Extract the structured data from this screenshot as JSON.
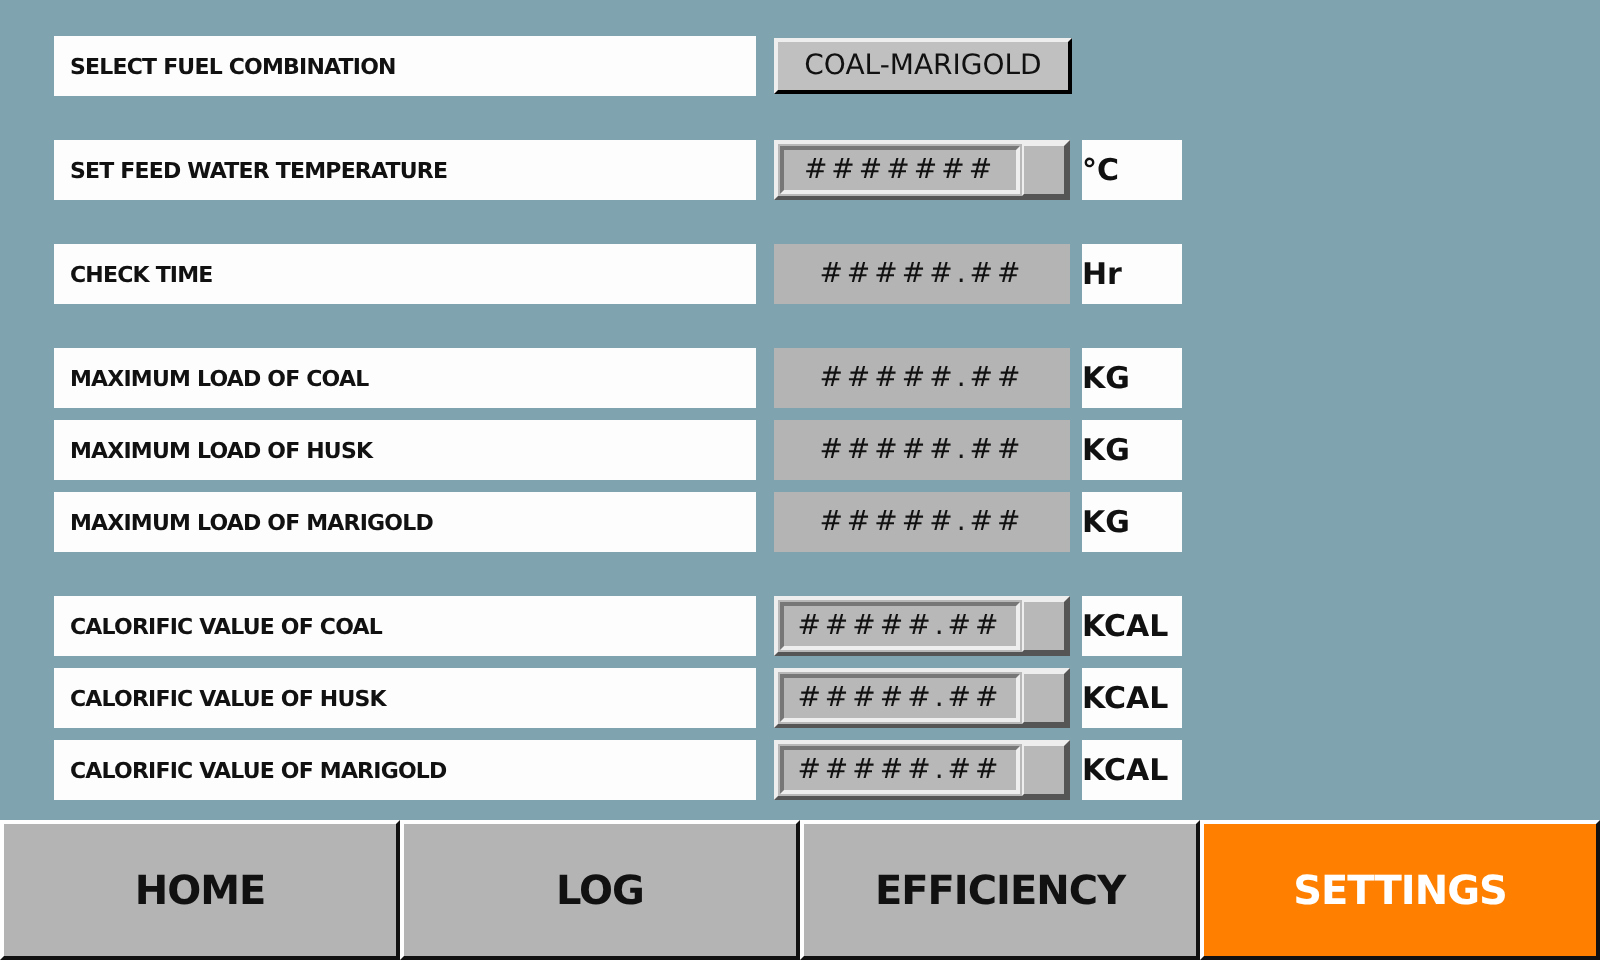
{
  "sections": [
    {
      "rows": [
        {
          "label": "SELECT FUEL COMBINATION",
          "kind": "button",
          "value": "COAL-MARIGOLD"
        }
      ]
    },
    {
      "rows": [
        {
          "label": "SET FEED WATER TEMPERATURE",
          "kind": "spinner",
          "value": "#######",
          "unit": "°C"
        }
      ]
    },
    {
      "rows": [
        {
          "label": "CHECK TIME",
          "kind": "display",
          "value": "#####.##",
          "unit": "Hr"
        }
      ]
    },
    {
      "rows": [
        {
          "label": "MAXIMUM LOAD OF COAL",
          "kind": "display",
          "value": "#####.##",
          "unit": "KG"
        },
        {
          "label": "MAXIMUM LOAD OF HUSK",
          "kind": "display",
          "value": "#####.##",
          "unit": "KG"
        },
        {
          "label": "MAXIMUM LOAD OF MARIGOLD",
          "kind": "display",
          "value": "#####.##",
          "unit": "KG"
        }
      ]
    },
    {
      "rows": [
        {
          "label": "CALORIFIC VALUE OF COAL",
          "kind": "spinner",
          "value": "#####.##",
          "unit": "KCAL"
        },
        {
          "label": "CALORIFIC VALUE OF HUSK",
          "kind": "spinner",
          "value": "#####.##",
          "unit": "KCAL"
        },
        {
          "label": "CALORIFIC VALUE OF MARIGOLD",
          "kind": "spinner",
          "value": "#####.##",
          "unit": "KCAL"
        }
      ]
    }
  ],
  "nav": [
    {
      "label": "HOME",
      "selected": false
    },
    {
      "label": "LOG",
      "selected": false
    },
    {
      "label": "EFFICIENCY",
      "selected": false
    },
    {
      "label": "SETTINGS",
      "selected": true
    }
  ]
}
